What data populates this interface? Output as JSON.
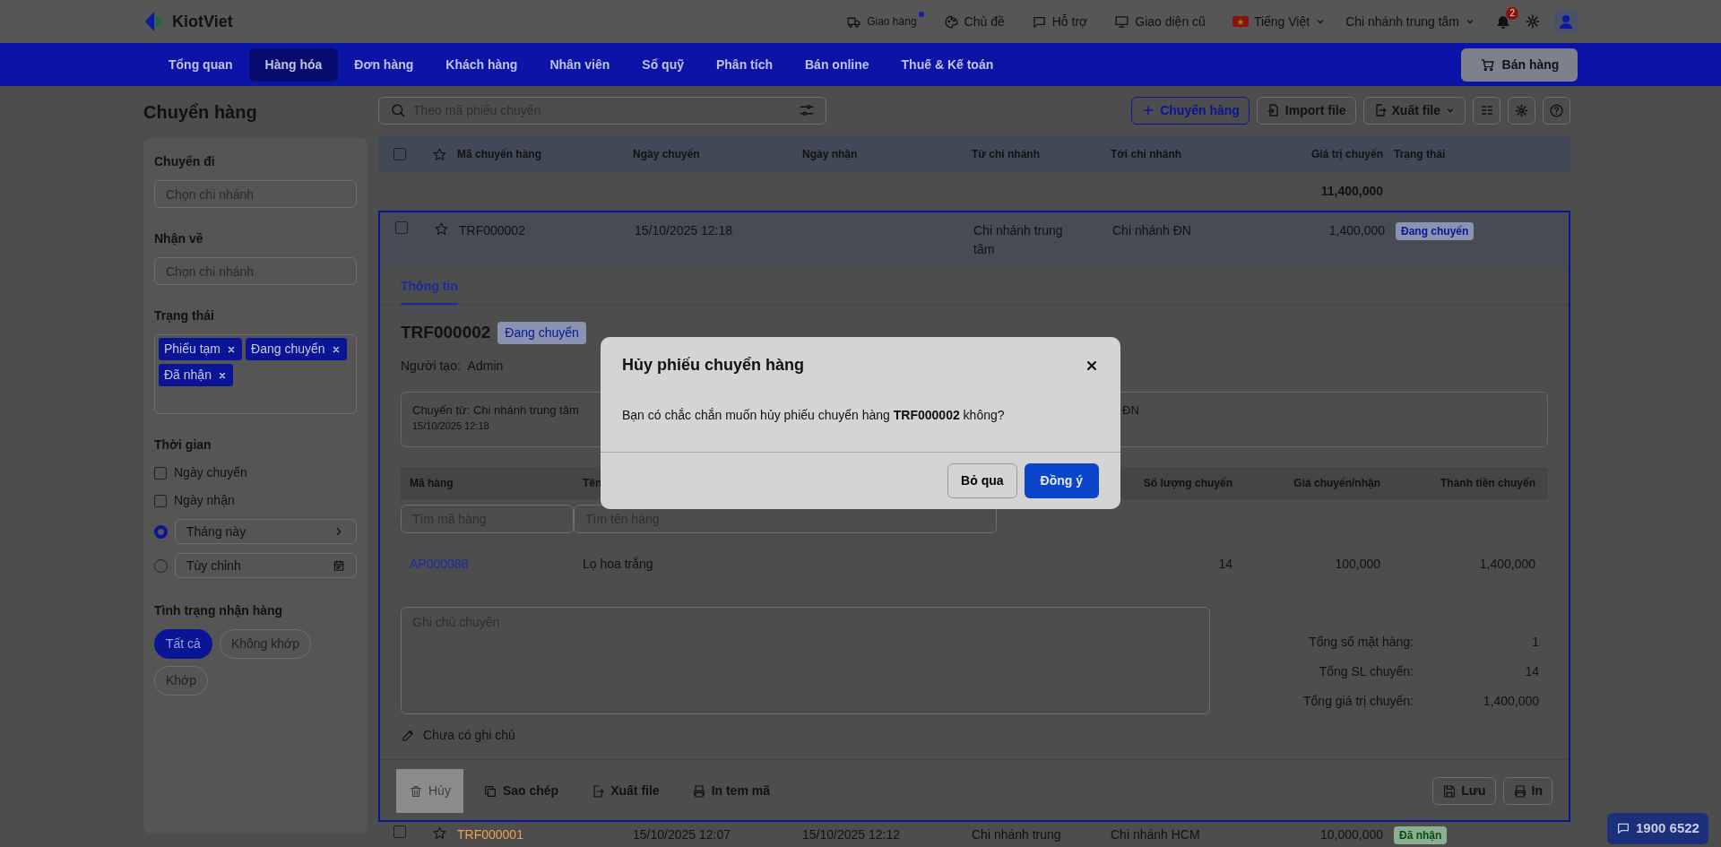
{
  "topbar": {
    "logo": "KiotViet",
    "links": [
      {
        "kind": "truck",
        "label": "Giao hàng",
        "dot": true
      },
      {
        "kind": "palette",
        "label": "Chủ đề",
        "dot": false
      },
      {
        "kind": "chat",
        "label": "Hỗ trợ",
        "dot": false
      },
      {
        "kind": "monitor",
        "label": "Giao diện cũ",
        "dot": false
      }
    ],
    "language": "Tiếng Việt",
    "branch": "Chi nhánh trung tâm",
    "notifications": "2"
  },
  "nav": {
    "items": [
      {
        "label": "Tổng quan",
        "selected": false
      },
      {
        "label": "Hàng hóa",
        "selected": true
      },
      {
        "label": "Đơn hàng",
        "selected": false
      },
      {
        "label": "Khách hàng",
        "selected": false
      },
      {
        "label": "Nhân viên",
        "selected": false
      },
      {
        "label": "Sổ quỹ",
        "selected": false
      },
      {
        "label": "Phân tích",
        "selected": false
      },
      {
        "label": "Bán online",
        "selected": false
      },
      {
        "label": "Thuế & Kế toán",
        "selected": false
      }
    ],
    "sell_button": "Bán hàng"
  },
  "page_title": "Chuyển hàng",
  "filters": {
    "sections": [
      {
        "kind": "select",
        "title": "Chuyển đi",
        "placeholder": "Chọn chi nhánh"
      },
      {
        "kind": "select",
        "title": "Nhận về",
        "placeholder": "Chọn chi nhánh"
      },
      {
        "kind": "tags",
        "title": "Trạng thái",
        "tags": [
          "Phiếu tạm",
          "Đang chuyển",
          "Đã nhận"
        ]
      },
      {
        "kind": "time",
        "title": "Thời gian",
        "checks": [
          {
            "label": "Ngày chuyển",
            "checked": false
          },
          {
            "label": "Ngày nhận",
            "checked": false
          }
        ],
        "radios": [
          {
            "label": "Tháng này",
            "selected": true,
            "kind": "preset"
          },
          {
            "label": "Tùy chỉnh",
            "selected": false,
            "kind": "custom"
          }
        ]
      },
      {
        "kind": "chips",
        "title": "Tình trạng nhận hàng",
        "chips": [
          {
            "label": "Tất cả",
            "selected": true
          },
          {
            "label": "Không khớp",
            "selected": false
          },
          {
            "label": "Khớp",
            "selected": false
          }
        ]
      }
    ]
  },
  "toolbar": {
    "search_placeholder": "Theo mã phiếu chuyển",
    "buttons": [
      {
        "kind": "add",
        "label": "Chuyển hàng"
      },
      {
        "kind": "import",
        "label": "Import file"
      },
      {
        "kind": "export",
        "label": "Xuất file"
      }
    ]
  },
  "table": {
    "all_checked": false,
    "columns": [
      "Mã chuyển hàng",
      "Ngày chuyển",
      "Ngày nhận",
      "Từ chi nhánh",
      "Tới chi nhánh",
      "Giá trị chuyển",
      "Trạng thái"
    ],
    "total": "11,400,000",
    "rows": [
      {
        "checked": false,
        "expanded": true,
        "cells": [
          "TRF000002",
          "15/10/2025 12:18",
          null,
          "Chi nhánh trung tâm",
          "Chi nhánh ĐN",
          "1,400,000"
        ],
        "status": "Đang chuyển",
        "kind": "transit"
      },
      {
        "checked": false,
        "expanded": false,
        "cells": [
          "TRF000001",
          "15/10/2025 12:07",
          "15/10/2025 12:12",
          "Chi nhánh trung",
          "Chi nhánh HCM",
          "10,000,000"
        ],
        "status": "Đã nhận",
        "kind": "received"
      }
    ]
  },
  "detail": {
    "tabs": [
      {
        "label": "Thông tin",
        "selected": true
      }
    ],
    "code": "TRF000002",
    "status": "Đang chuyển",
    "creator_label": "Người tạo:",
    "creator": "Admin",
    "route_from": "Chuyển từ: Chi nhánh trung tâm",
    "route_date": "15/10/2025 12:18",
    "route_to": "ĐN",
    "item_columns": [
      "Mã hàng",
      "Tên",
      "Số lượng chuyển",
      "Giá chuyển/nhận",
      "Thành tiền chuyển"
    ],
    "code_filter_placeholder": "Tìm mã hàng",
    "name_filter_placeholder": "Tìm tên hàng",
    "items": [
      {
        "code": "AP000088",
        "name": "Lọ hoa trắng",
        "qty": "14",
        "price": "100,000",
        "amount": "1,400,000"
      }
    ],
    "note_placeholder": "Ghi chú chuyển",
    "note_status": "Chưa có ghi chú",
    "summary": [
      {
        "label": "Tổng số mặt hàng:",
        "value": "1"
      },
      {
        "label": "Tổng SL chuyển:",
        "value": "14"
      },
      {
        "label": "Tổng giá trị chuyển:",
        "value": "1,400,000"
      }
    ],
    "actions": [
      {
        "kind": "trash",
        "label": "Hủy",
        "highlighted": true
      },
      {
        "kind": "copy",
        "label": "Sao chép",
        "highlighted": false
      },
      {
        "kind": "export",
        "label": "Xuất file",
        "highlighted": false
      },
      {
        "kind": "print",
        "label": "In tem mã",
        "highlighted": false
      }
    ],
    "right_actions": [
      {
        "kind": "save",
        "label": "Lưu"
      },
      {
        "kind": "print",
        "label": "In"
      }
    ]
  },
  "modal": {
    "title": "Hủy phiếu chuyển hàng",
    "message": "Bạn có chắc chắn muốn hủy phiếu chuyển hàng **TRF000002** không?",
    "cancel": "Bỏ qua",
    "confirm": "Đồng ý"
  },
  "hotline": "1900 6522"
}
